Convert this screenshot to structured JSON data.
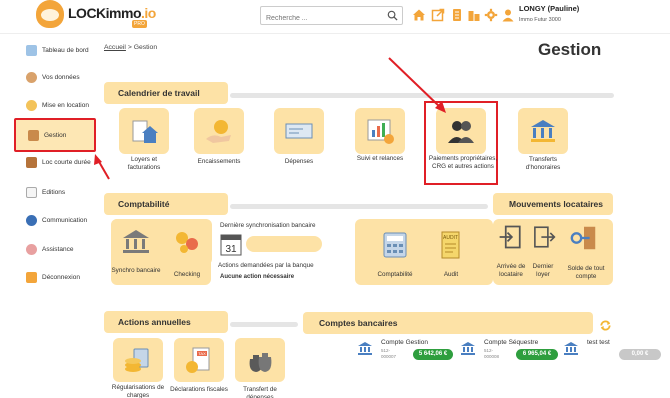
{
  "header": {
    "logo_text": "LOCKimmo",
    "logo_suffix": ".io",
    "logo_badge": "PRO",
    "search_placeholder": "Recherche ...",
    "user_name": "LONGY (Pauline)",
    "user_org": "Immo Futur 3000"
  },
  "sidebar": {
    "items": [
      {
        "label": "Tableau de bord"
      },
      {
        "label": "Vos données"
      },
      {
        "label": "Mise en location"
      },
      {
        "label": "Gestion"
      },
      {
        "label": "Loc courte durée"
      },
      {
        "label": "Editions"
      },
      {
        "label": "Communication"
      },
      {
        "label": "Assistance"
      },
      {
        "label": "Déconnexion"
      }
    ]
  },
  "breadcrumb": {
    "home": "Accueil",
    "separator": ">",
    "current": "Gestion"
  },
  "page_title": "Gestion",
  "calendrier": {
    "title": "Calendrier de travail",
    "tiles": [
      {
        "label": "Loyers et facturations"
      },
      {
        "label": "Encaissements"
      },
      {
        "label": "Dépenses"
      },
      {
        "label": "Suivi et relances"
      },
      {
        "label": "Paiements propriétaires, CRG et autres actions"
      },
      {
        "label": "Transferts d'honoraires"
      }
    ]
  },
  "comptabilite": {
    "title": "Comptabilité",
    "tiles": [
      {
        "label": "Synchro bancaire"
      },
      {
        "label": "Checking"
      },
      {
        "label": "Comptabilité"
      },
      {
        "label": "Audit"
      }
    ],
    "sync_title": "Dernière synchronisation bancaire",
    "calendar_day": "31",
    "actions_label": "Actions demandées par la banque",
    "actions_value": "Aucune action nécessaire",
    "audit_badge": "AUDIT"
  },
  "mouvements": {
    "title": "Mouvements locataires",
    "tiles": [
      {
        "label": "Arrivée de locataire"
      },
      {
        "label": "Dernier loyer"
      },
      {
        "label": "Solde de tout compte"
      }
    ]
  },
  "annuelles": {
    "title": "Actions annuelles",
    "tiles": [
      {
        "label": "Régularisations de charges"
      },
      {
        "label": "Déclarations fiscales"
      },
      {
        "label": "Transfert de dépenses"
      }
    ],
    "tax_badge": "TAX"
  },
  "comptes": {
    "title": "Comptes bancaires",
    "accounts": [
      {
        "name": "Compte Gestion",
        "number": "512-000007",
        "amount": "5 642,06 €",
        "color": "#2e9e3e"
      },
      {
        "name": "Compte Séquestre",
        "number": "512-000008",
        "amount": "6 965,04 €",
        "color": "#2e9e3e"
      },
      {
        "name": "test test",
        "number": "",
        "amount": "0,00 €",
        "color": "#c8c8c8"
      }
    ]
  },
  "colors": {
    "accent": "#fde2a6",
    "highlight": "#e01f26",
    "orange": "#f3a53a",
    "green": "#2e9e3e"
  }
}
